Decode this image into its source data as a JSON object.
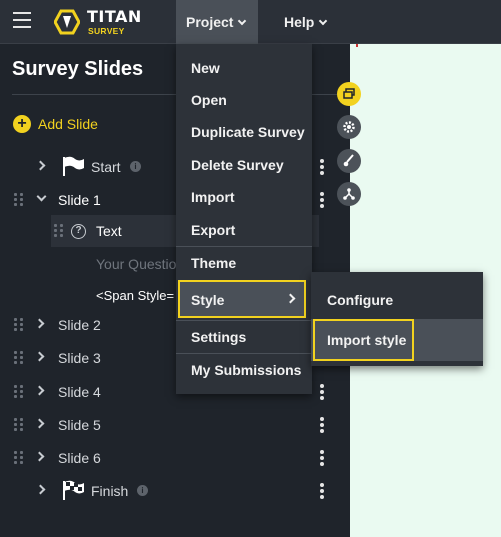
{
  "header": {
    "logo_title": "TITAN",
    "logo_subtitle": "SURVEY",
    "menu": [
      {
        "label": "Project"
      },
      {
        "label": "Help"
      }
    ]
  },
  "sidebar": {
    "title": "Survey Slides",
    "add_slide_label": "Add Slide",
    "rows": {
      "start": "Start",
      "slide1": "Slide 1",
      "text": "Text",
      "question": "Your Questio",
      "span": "<Span Style=",
      "slide2": "Slide 2",
      "slide3": "Slide 3",
      "slide4": "Slide 4",
      "slide5": "Slide 5",
      "slide6": "Slide 6",
      "finish": "Finish"
    }
  },
  "project_menu": {
    "items": [
      "New",
      "Open",
      "Duplicate Survey",
      "Delete Survey",
      "Import",
      "Export",
      "Theme",
      "Style",
      "Settings",
      "My Submissions"
    ]
  },
  "style_submenu": {
    "items": [
      "Configure",
      "Import style"
    ]
  },
  "colors": {
    "accent": "#f2d21f",
    "topbar": "#2b3038",
    "sidebar": "#1f242b",
    "canvas": "#eafaf1",
    "highlight": "#4a5058"
  }
}
